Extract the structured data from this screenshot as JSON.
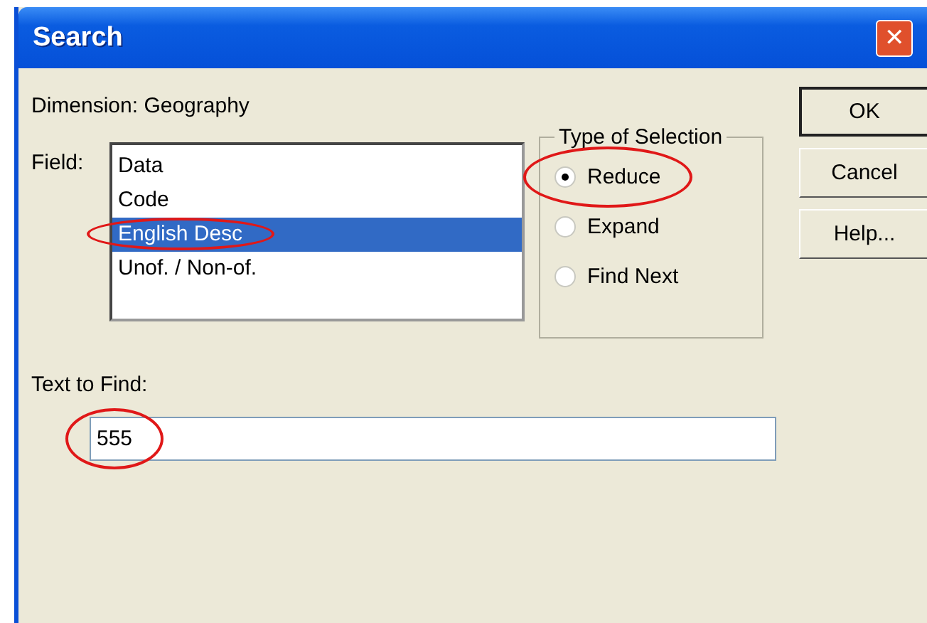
{
  "window": {
    "title": "Search",
    "close_glyph": "✕"
  },
  "dimension_label": "Dimension: Geography",
  "field": {
    "label": "Field:",
    "items": [
      {
        "text": "Data",
        "selected": false,
        "circled": false
      },
      {
        "text": "Code",
        "selected": false,
        "circled": false
      },
      {
        "text": "English Desc",
        "selected": true,
        "circled": true
      },
      {
        "text": "Unof. / Non-of.",
        "selected": false,
        "circled": false
      }
    ]
  },
  "selection_type": {
    "title": "Type of Selection",
    "options": [
      {
        "label": "Reduce",
        "selected": true,
        "circled": true
      },
      {
        "label": "Expand",
        "selected": false,
        "circled": false
      },
      {
        "label": "Find Next",
        "selected": false,
        "circled": false
      }
    ]
  },
  "buttons": [
    "OK",
    "Cancel",
    "Help..."
  ],
  "text_to_find": {
    "label": "Text to Find:",
    "value": "555",
    "circled": true
  }
}
